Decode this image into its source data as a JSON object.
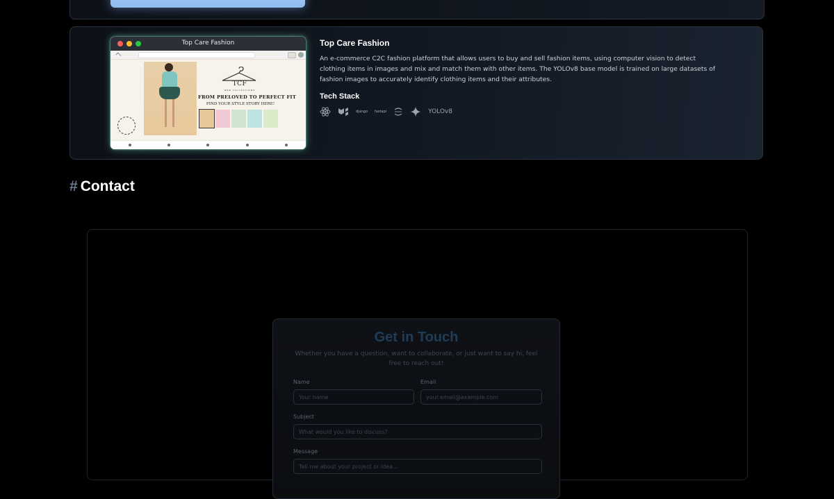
{
  "project": {
    "window_title": "Top Care Fashion",
    "title": "Top Care Fashion",
    "description": "An e-commerce C2C fashion platform that allows users to buy and sell fashion items, using computer vision to detect clothing items in images and mix and match them with other items. The YOLOv8 base model is trained on large datasets of fashion images to accurately identify clothing items and their attributes.",
    "screenshot": {
      "brand": "TCF",
      "brand_sub": "NEW COLLECTIONS",
      "headline": "FROM PRELOVED TO PERFECT FIT",
      "subline": "FIND YOUR STYLE STORY HERE!"
    },
    "tech_stack_title": "Tech Stack",
    "tech_stack": [
      {
        "icon": "react-icon"
      },
      {
        "icon": "mui-icon"
      },
      {
        "icon": "django-icon",
        "text": "django"
      },
      {
        "icon": "fastapi-icon",
        "text": "fastapi"
      },
      {
        "icon": "refresh-icon"
      },
      {
        "icon": "sparkle-icon"
      },
      {
        "icon": "yolo-label",
        "text": "YOLOv8"
      }
    ]
  },
  "contact": {
    "hash": "#",
    "heading": "Contact",
    "form_title": "Get in Touch",
    "form_subtitle": "Whether you have a question, want to collaborate, or just want to say hi, feel free to reach out!",
    "name_label": "Name",
    "name_placeholder": "Your name",
    "email_label": "Email",
    "email_placeholder": "your.email@example.com",
    "subject_label": "Subject",
    "subject_placeholder": "What would you like to discuss?",
    "message_label": "Message",
    "message_placeholder": "Tell me about your project or idea..."
  },
  "colors": {
    "page_bg": "#000000",
    "card_border": "#2c3442",
    "form_title": "#1f3d58",
    "muted_text": "#3e4654"
  }
}
